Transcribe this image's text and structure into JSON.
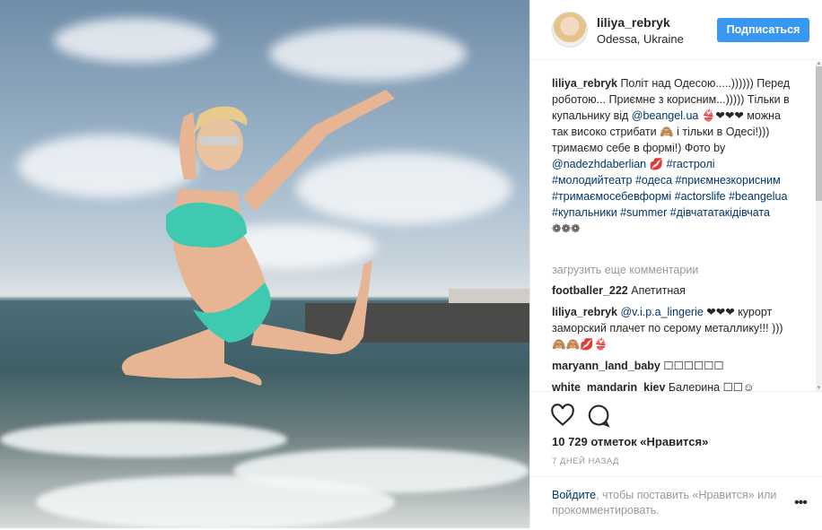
{
  "post": {
    "username": "liliya_rebryk",
    "location": "Odessa, Ukraine",
    "follow_label": "Подписаться"
  },
  "caption": {
    "username": "liliya_rebryk",
    "t1": " Політ над Одесою.....)))))) Перед роботою... Приємне з корисним...))))) Тільки в купальнику від ",
    "link1": "@beangel.ua",
    "t2": " 👙❤❤❤ можна так високо стрибати 🙈 і тільки в Одесі!))) тримаємо себе в формі!) Фото by ",
    "link2": "@nadezhdaberlian",
    "t3": " 💋 ",
    "tags": "#гастролі #молодийтеатр #одеса #приємнезкорисним #тримаємосебевформі #actorslife #beangelua #купальники #summer #дівчататакідівчата",
    "t4": " ❁❁❁"
  },
  "load_more": "загрузить еще комментарии",
  "comments": [
    {
      "user": "footballer_222",
      "pre": " Апетитная",
      "link": "",
      "post": ""
    },
    {
      "user": "liliya_rebryk",
      "pre": " ",
      "link": "@v.i.p.a_lingerie",
      "post": " ❤❤❤ курорт заморский плачет по серому металлику!!! ))) 🙈🙈💋👙"
    },
    {
      "user": "maryann_land_baby",
      "pre": " ☐☐☐☐☐☐",
      "link": "",
      "post": ""
    },
    {
      "user": "white_mandarin_kiev",
      "pre": " Балерина ☐☐☺",
      "link": "",
      "post": ""
    }
  ],
  "likes": "10 729 отметок «Нравится»",
  "date": "7 ДНЕЙ НАЗАД",
  "login": {
    "link": "Войдите",
    "rest": ", чтобы поставить «Нравится» или прокомментировать."
  },
  "icons": {
    "like": "heart-icon",
    "comment": "comment-icon",
    "more": "more-options-icon"
  }
}
